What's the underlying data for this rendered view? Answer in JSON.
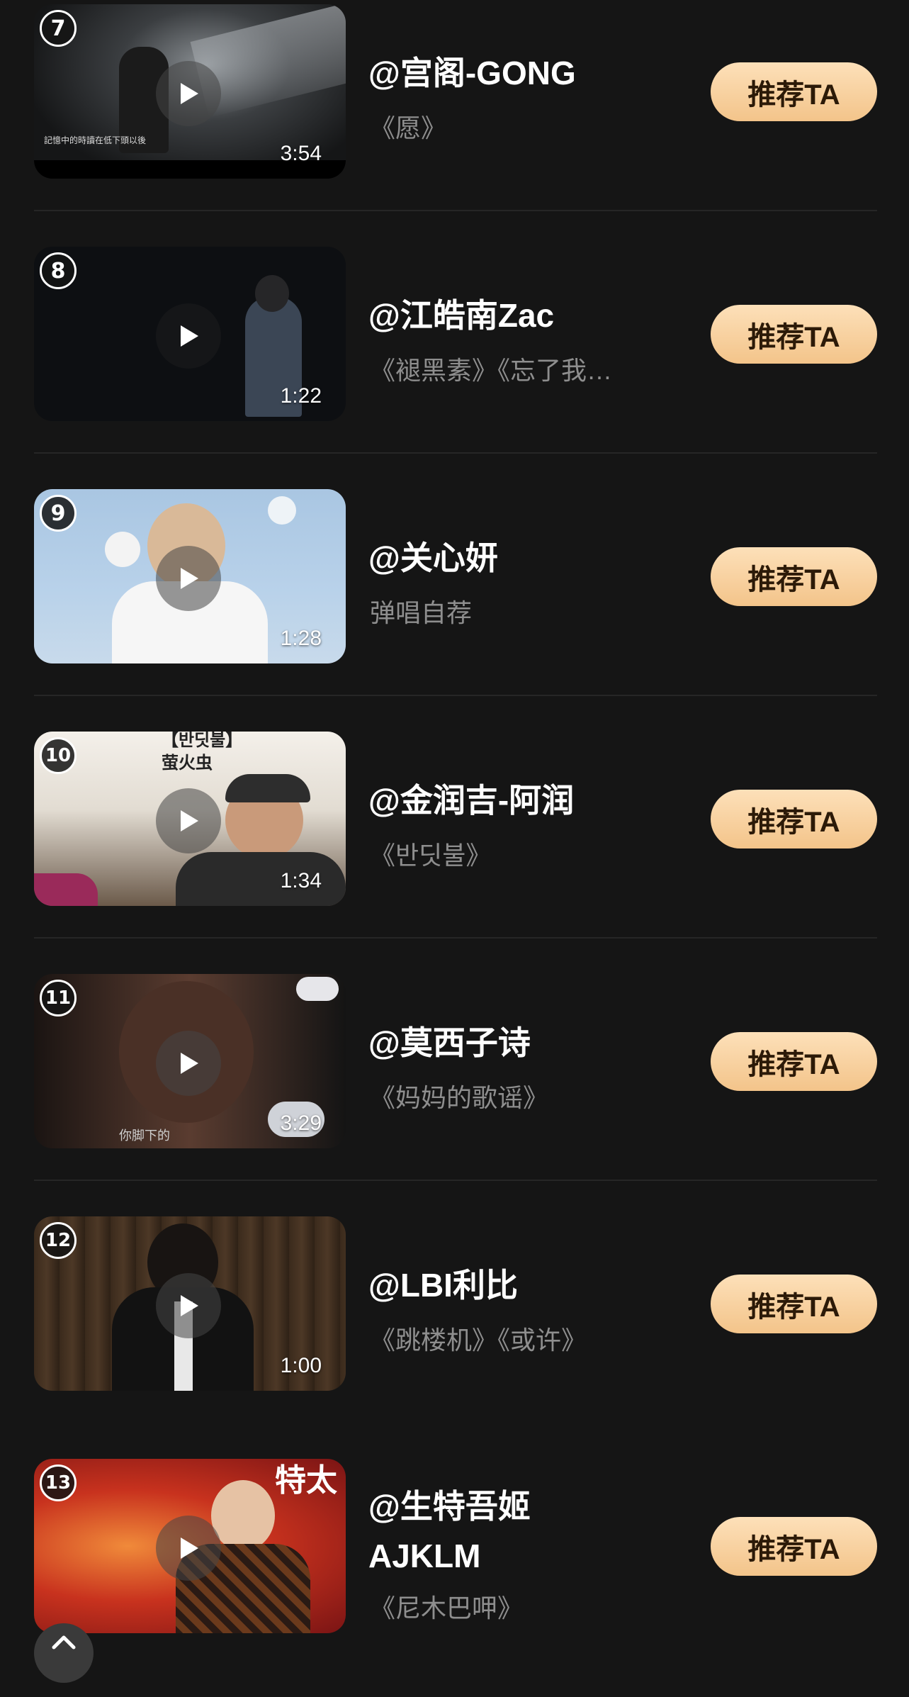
{
  "items": [
    {
      "rank": "7",
      "name": "@宫阁-GONG",
      "songs": "《愿》",
      "duration": "3:54",
      "button": "推荐TA",
      "caption": "記憶中的時讀在低下頭以後"
    },
    {
      "rank": "8",
      "name": "@江皓南Zac",
      "songs": "《褪黑素》《忘了我…",
      "duration": "1:22",
      "button": "推荐TA"
    },
    {
      "rank": "9",
      "name": "@关心妍",
      "songs": "弹唱自荐",
      "duration": "1:28",
      "button": "推荐TA"
    },
    {
      "rank": "10",
      "name": "@金润吉-阿润",
      "songs": "《반딧불》",
      "duration": "1:34",
      "button": "推荐TA",
      "overlay_top": "【반딧불】",
      "overlay_sub": "萤火虫"
    },
    {
      "rank": "11",
      "name": "@莫西子诗",
      "songs": "《妈妈的歌谣》",
      "duration": "3:29",
      "button": "推荐TA",
      "caption": "你脚下的"
    },
    {
      "rank": "12",
      "name": "@LBI利比",
      "songs": "《跳楼机》《或许》",
      "duration": "1:00",
      "button": "推荐TA"
    },
    {
      "rank": "13",
      "name_line1": "@生特吾姬",
      "name_line2": "AJKLM",
      "songs": "《尼木巴呷》",
      "button": "推荐TA",
      "overlay_top": "特太"
    }
  ],
  "colors": {
    "background": "#151515",
    "button_gradient_top": "#fde0b9",
    "button_gradient_bottom": "#f3c48a",
    "subtitle": "#8e8e8e"
  },
  "icons": {
    "play": "play-icon",
    "scroll_top": "chevron-up-icon"
  }
}
